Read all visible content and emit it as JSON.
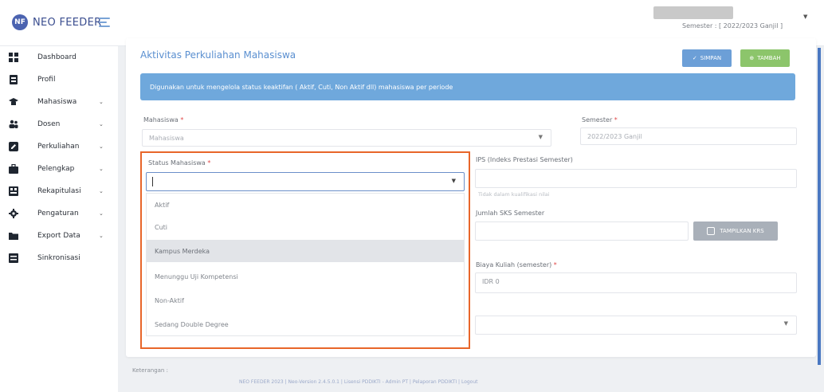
{
  "app": {
    "brand": "NEO FEEDER",
    "semester_label": "Semester : [ 2022/2023 Ganjil ]"
  },
  "sidebar": {
    "items": [
      {
        "label": "Dashboard",
        "icon": "dashboard-icon",
        "has_children": false
      },
      {
        "label": "Profil",
        "icon": "profile-icon",
        "has_children": false
      },
      {
        "label": "Mahasiswa",
        "icon": "graduation-cap-icon",
        "has_children": true
      },
      {
        "label": "Dosen",
        "icon": "users-icon",
        "has_children": true
      },
      {
        "label": "Perkuliahan",
        "icon": "edit-icon",
        "has_children": true
      },
      {
        "label": "Pelengkap",
        "icon": "briefcase-icon",
        "has_children": true
      },
      {
        "label": "Rekapitulasi",
        "icon": "report-icon",
        "has_children": true
      },
      {
        "label": "Pengaturan",
        "icon": "gear-icon",
        "has_children": true
      },
      {
        "label": "Export Data",
        "icon": "folder-icon",
        "has_children": true
      },
      {
        "label": "Sinkronisasi",
        "icon": "sync-icon",
        "has_children": false
      }
    ]
  },
  "main": {
    "title": "Aktivitas Perkuliahan Mahasiswa",
    "save_label": "SIMPAN",
    "add_label": "TAMBAH",
    "info": "Digunakan untuk mengelola status keaktifan ( Aktif, Cuti, Non Aktif dll) mahasiswa per periode",
    "fields": {
      "mahasiswa": {
        "label": "Mahasiswa",
        "placeholder": "Mahasiswa"
      },
      "semester": {
        "label": "Semester",
        "value": "2022/2023 Ganjil"
      },
      "status": {
        "label": "Status Mahasiswa",
        "value": ""
      },
      "ips": {
        "label": "IPS (Indeks Prestasi Semester)",
        "hint": "Tidak dalam kualifikasi nilai"
      },
      "sks": {
        "label": "Jumlah SKS Semester"
      },
      "biaya": {
        "label": "Biaya Kuliah (semester)",
        "value": "IDR 0"
      }
    },
    "krs_button": "TAMPILKAN KRS",
    "status_options": [
      "Aktif",
      "Cuti",
      "Kampus Merdeka",
      "Menunggu Uji Kompetensi",
      "Non-Aktif",
      "Sedang Double Degree"
    ],
    "active_option_index": 2
  },
  "footer": {
    "label": "Keterangan :",
    "text": "NEO FEEDER 2023 | Neo-Version 2.4.5.0.1 | Lisensi PDDIKTI - Admin PT | Pelaporan PDDIKTI | Logout"
  },
  "colors": {
    "accent": "#6fa8dc",
    "highlight": "#e8662a",
    "save": "#6c9fd7",
    "add": "#8cc56b"
  }
}
